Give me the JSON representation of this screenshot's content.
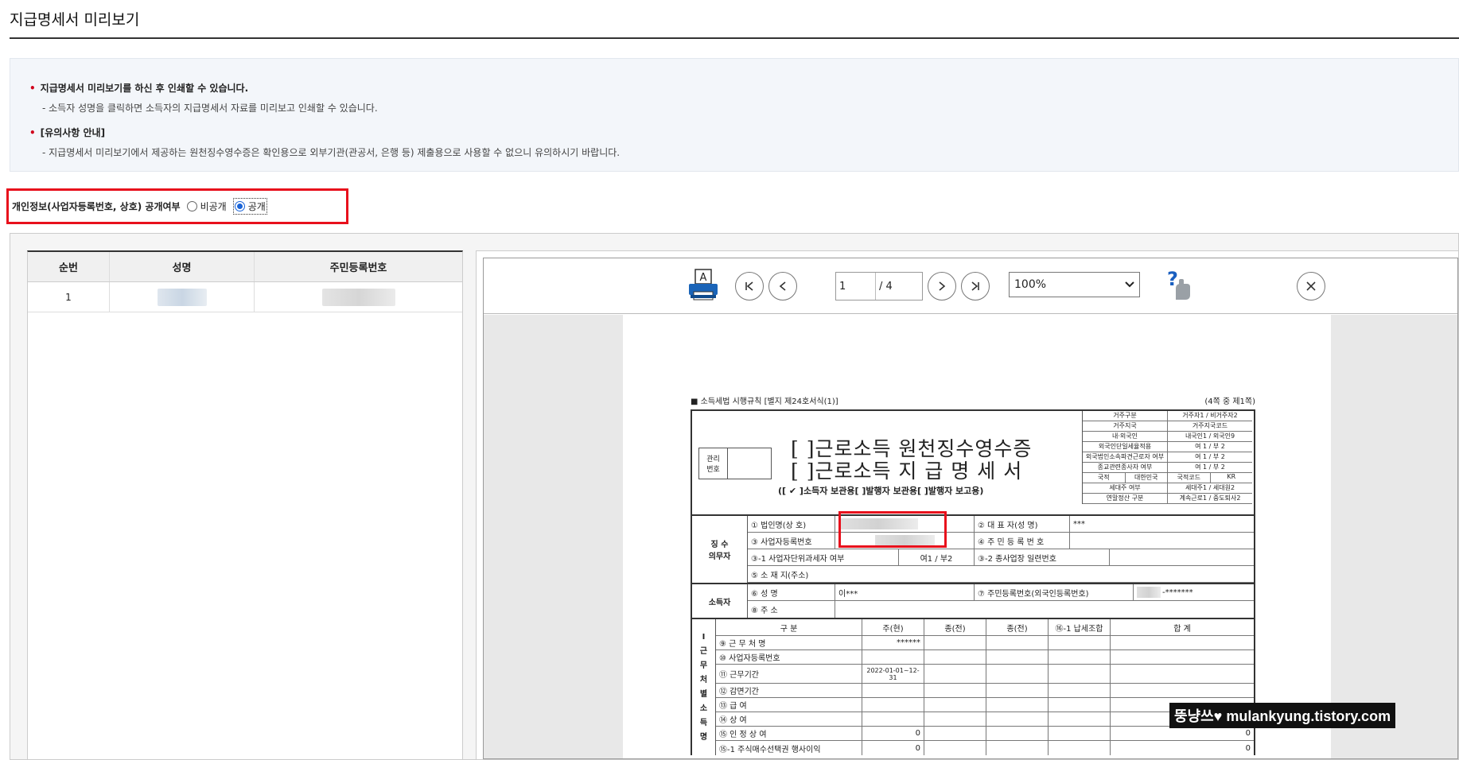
{
  "page": {
    "title": "지급명세서 미리보기"
  },
  "notice": {
    "item1_head": "지급명세서 미리보기를 하신 후 인쇄할 수 있습니다.",
    "item1_sub": "- 소득자 성명을 클릭하면 소득자의 지급명세서 자료를 미리보고 인쇄할 수 있습니다.",
    "item2_head": "[유의사항 안내]",
    "item2_sub": "- 지급명세서 미리보기에서 제공하는 원천징수영수증은 확인용으로 외부기관(관공서, 은행 등) 제출용으로 사용할 수 없으니 유의하시기 바랍니다."
  },
  "privacy": {
    "label": "개인정보(사업자등록번호, 상호) 공개여부",
    "option_private": "비공개",
    "option_public": "공개",
    "selected": "공개"
  },
  "list": {
    "headers": [
      "순번",
      "성명",
      "주민등록번호"
    ],
    "rows": [
      {
        "no": "1"
      }
    ]
  },
  "viewer": {
    "current_page": "1",
    "total_pages": "/ 4",
    "zoom": "100%",
    "icons": [
      "print-icon",
      "first-page-icon",
      "prev-page-icon",
      "next-page-icon",
      "last-page-icon",
      "help-icon",
      "close-icon"
    ]
  },
  "form": {
    "law": "■ 소득세법 시행규칙 [별지 제24호서식(1)]",
    "page_of": "(4쪽 중 제1쪽)",
    "gwanri": "관리\n번호",
    "title1": "[  ]근로소득 원천징수영수증",
    "title2": "[  ]근로소득 지 급 명 세 서",
    "copies": "([ ✔ ]소득자 보관용[    ]발행자 보관용[    ]발행자 보고용)",
    "side": [
      [
        "거주구분",
        "거주자1 / 비거주자2"
      ],
      [
        "거주지국",
        "거주지국코드"
      ],
      [
        "내·외국인",
        "내국인1 / 외국인9"
      ],
      [
        "외국인단일세율적용",
        "여 1 / 부 2"
      ],
      [
        "외국법인소속파견근로자 여부",
        "여 1 / 부 2"
      ],
      [
        "종교관련종사자 여부",
        "여 1 / 부 2"
      ],
      [
        "국적",
        "대한민국",
        "국적코드",
        "KR"
      ],
      [
        "세대주 여부",
        "세대주1 / 세대원2"
      ],
      [
        "연말정산 구분",
        "계속근로1 / 중도퇴사2"
      ]
    ],
    "payer_label": "징 수\n의무자",
    "payer_rows": {
      "corp": "① 법인명(상 호)",
      "rep": "② 대 표 자(성 명)",
      "rep_val": "***",
      "bizno": "③ 사업자등록번호",
      "rrn": "④ 주 민 등 록 번 호",
      "unit": "③-1 사업자단위과세자 여부",
      "unit_val": "여1 / 부2",
      "sub": "③-2 종사업장 일련번호",
      "addr": "⑤ 소 재 지(주소)"
    },
    "earner_label": "소득자",
    "earner_rows": {
      "name": "⑥ 성        명",
      "name_val": "이***",
      "rrn": "⑦ 주민등록번호(외국인등록번호)",
      "rrn_val": "-*******",
      "addr": "⑧ 주        소"
    },
    "income_label": "Ⅰ\n근\n무\n처\n별\n소\n득\n명",
    "income_headers": [
      "구    분",
      "주(현)",
      "종(전)",
      "종(전)",
      "⑯-1 납세조합",
      "합  계"
    ],
    "income_rows": [
      {
        "label": "⑨ 근 무 처 명",
        "v1": "******",
        "v6": ""
      },
      {
        "label": "⑩ 사업자등록번호",
        "v1": "",
        "v6": ""
      },
      {
        "label": "⑪ 근무기간",
        "v1": "2022-01-01~12-31",
        "v6": ""
      },
      {
        "label": "⑫ 감면기간",
        "v1": "",
        "v6": ""
      },
      {
        "label": "⑬ 급        여",
        "v1": "",
        "v6": ""
      },
      {
        "label": "⑭ 상        여",
        "v1": "",
        "v6": ""
      },
      {
        "label": "⑮ 인 정 상 여",
        "v1": "0",
        "v6": "0"
      },
      {
        "label": "⑮-1 주식매수선택권 행사이익",
        "v1": "0",
        "v6": "0"
      }
    ]
  },
  "watermark": "뚱냥쓰♥ mulankyung.tistory.com"
}
